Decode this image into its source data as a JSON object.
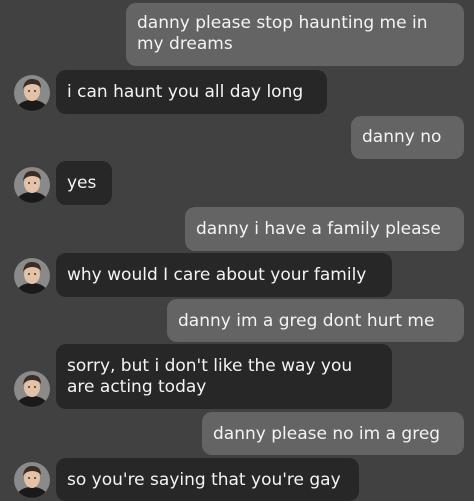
{
  "messages": [
    {
      "side": "sent",
      "lines": [
        "danny please stop haunting me in",
        "my dreams"
      ]
    },
    {
      "side": "received",
      "lines": [
        "i can haunt you all day long"
      ]
    },
    {
      "side": "sent",
      "lines": [
        "danny no"
      ]
    },
    {
      "side": "received",
      "lines": [
        "yes"
      ]
    },
    {
      "side": "sent",
      "lines": [
        "danny i have a family please"
      ]
    },
    {
      "side": "received",
      "lines": [
        "why would I care about your family"
      ]
    },
    {
      "side": "sent",
      "lines": [
        "danny im a greg dont hurt me"
      ]
    },
    {
      "side": "received",
      "lines": [
        "sorry, but i don't like the way you",
        "are acting today"
      ]
    },
    {
      "side": "sent",
      "lines": [
        "danny please no im a greg"
      ]
    },
    {
      "side": "received",
      "lines": [
        "so you're saying that you're gay"
      ]
    }
  ],
  "avatar": {
    "icon": "profile-photo-avatar"
  },
  "colors": {
    "background": "#414141",
    "sent_bubble": "#646464",
    "received_bubble": "#272727",
    "text": "#f4f4f4"
  }
}
